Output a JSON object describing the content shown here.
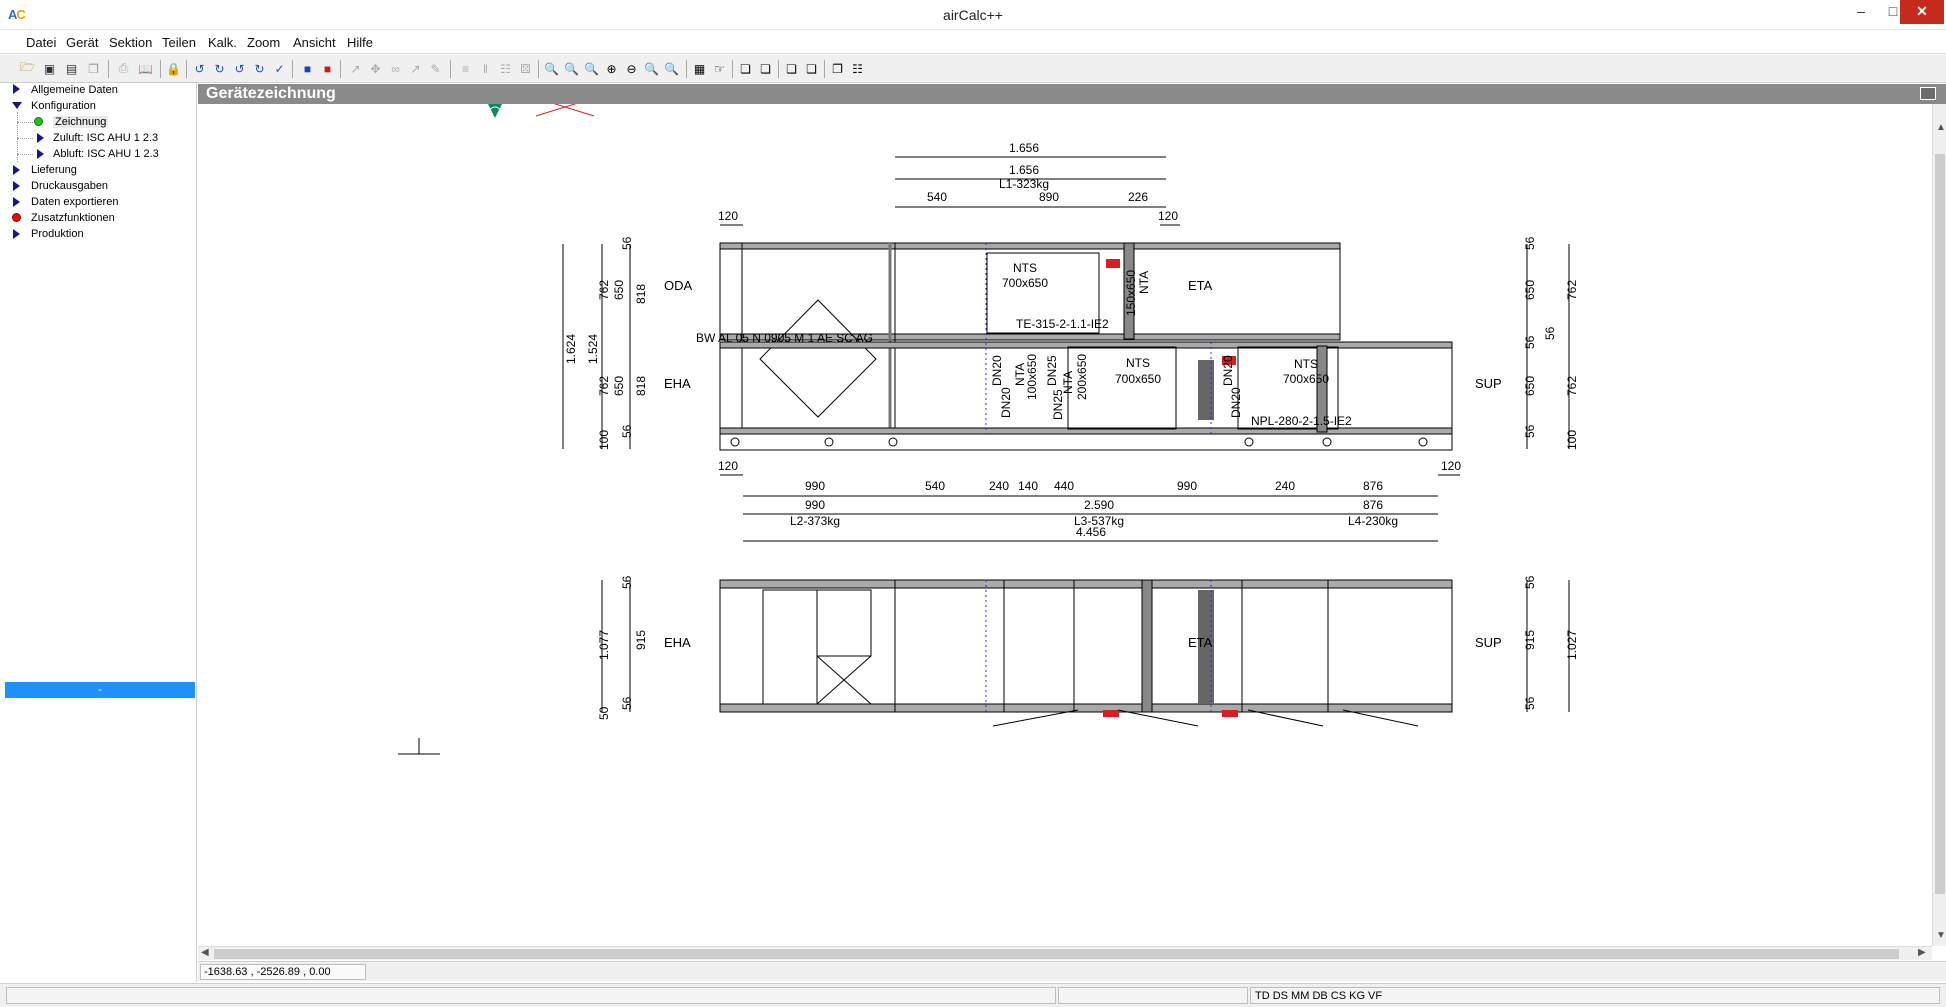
{
  "window": {
    "title": "airCalc++",
    "logo_a": "A",
    "logo_c": "C"
  },
  "menu": [
    "Datei",
    "Gerät",
    "Sektion",
    "Teilen",
    "Kalk.",
    "Zoom",
    "Ansicht",
    "Hilfe"
  ],
  "tree": {
    "items": [
      {
        "label": "Allgemeine Daten",
        "icon": "triangle-right-icon"
      },
      {
        "label": "Konfiguration",
        "icon": "triangle-down-icon"
      },
      {
        "label": "Zeichnung",
        "icon": "green-dot-icon"
      },
      {
        "label": "Zuluft: ISC AHU 1 2.3",
        "icon": "triangle-right-icon"
      },
      {
        "label": "Abluft: ISC AHU 1 2.3",
        "icon": "triangle-right-icon"
      },
      {
        "label": "Lieferung",
        "icon": "triangle-right-icon"
      },
      {
        "label": "Druckausgaben",
        "icon": "triangle-right-icon"
      },
      {
        "label": "Daten exportieren",
        "icon": "triangle-right-icon"
      },
      {
        "label": "Zusatzfunktionen",
        "icon": "red-dot-icon"
      },
      {
        "label": "Produktion",
        "icon": "triangle-right-icon"
      }
    ],
    "selected_bar": "-"
  },
  "panel": {
    "title": "Gerätezeichnung"
  },
  "drawing": {
    "dims_top": [
      "1.656",
      "1.656",
      "L1-323kg",
      "540",
      "890",
      "226",
      "120",
      "120"
    ],
    "left_dims": [
      "56",
      "762",
      "650",
      "818",
      "1.524",
      "1.624",
      "762",
      "650",
      "818",
      "100",
      "56"
    ],
    "right_dims": [
      "56",
      "650",
      "762",
      "56",
      "56",
      "650",
      "762",
      "56",
      "100"
    ],
    "labels_side": [
      "ODA",
      "EHA",
      "ETA",
      "SUP"
    ],
    "components": [
      "NTS",
      "700x650",
      "TE-315-2-1.1-IE2",
      "150x650",
      "NTA",
      "BW AL 05 N 0905 M 1 AE SC AG",
      "DN20",
      "NTA",
      "100x650",
      "DN20",
      "DN25",
      "NTA",
      "200x650",
      "DN25",
      "NTS",
      "700x650",
      "DN20",
      "DN20",
      "NTS",
      "700x650",
      "NPL-280-2-1.5-IE2"
    ],
    "dims_mid": [
      "120",
      "120",
      "990",
      "540",
      "240",
      "140",
      "440",
      "990",
      "240",
      "876",
      "990",
      "2.590",
      "876",
      "L2-373kg",
      "L3-537kg",
      "L4-230kg",
      "4.456"
    ],
    "bottom_labels": [
      "EHA",
      "ETA",
      "SUP"
    ],
    "bottom_dims_left": [
      "56",
      "1.077",
      "915",
      "50",
      "56"
    ],
    "bottom_dims_right": [
      "56",
      "915",
      "1.027",
      "56"
    ]
  },
  "coords": "-1638.63 , -2526.89 , 0.00",
  "status": {
    "codes": "TD DS MM DB CS KG VF"
  },
  "colors": {
    "accent": "#1e90ff",
    "header": "#8a8a8a",
    "close": "#c42b1c",
    "tree_icon": "#121a7a"
  }
}
